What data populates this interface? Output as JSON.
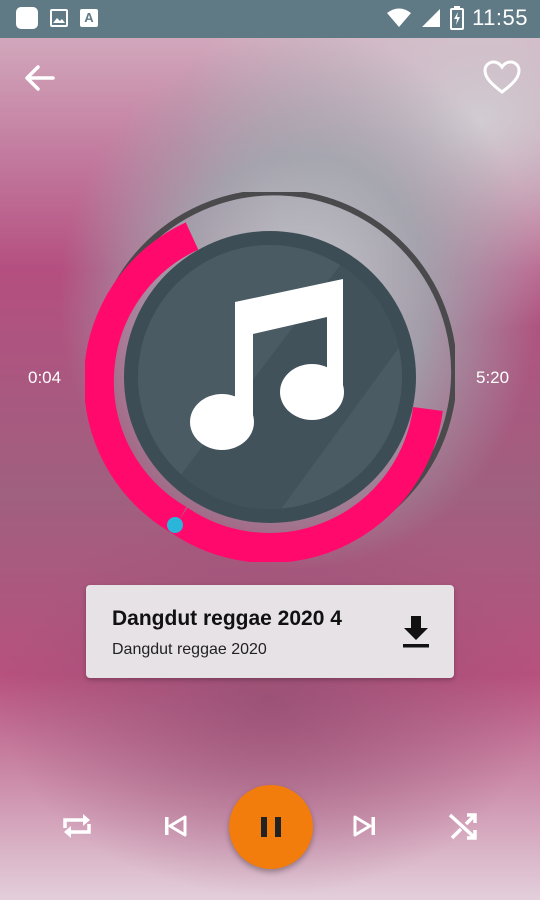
{
  "status_bar": {
    "time": "11:55",
    "icons": [
      "notification-square-icon",
      "image-icon",
      "text-a-icon",
      "wifi-icon",
      "signal-icon",
      "battery-charging-icon"
    ]
  },
  "header": {
    "back_icon": "arrow-left-icon",
    "favorite_icon": "heart-outline-icon"
  },
  "player": {
    "elapsed": "0:04",
    "duration": "5:20",
    "progress_fraction": 0.0125,
    "artwork_icon": "music-note-icon",
    "accent_color": "#ff0a6c",
    "progress_dot_color": "#29b6d8"
  },
  "track": {
    "title": "Dangdut reggae 2020 4",
    "album": "Dangdut reggae 2020",
    "download_icon": "download-icon"
  },
  "controls": {
    "repeat_icon": "repeat-icon",
    "previous_icon": "skip-previous-icon",
    "play_pause_icon": "pause-icon",
    "play_color": "#f27c0c",
    "next_icon": "skip-next-icon",
    "shuffle_icon": "shuffle-icon"
  }
}
